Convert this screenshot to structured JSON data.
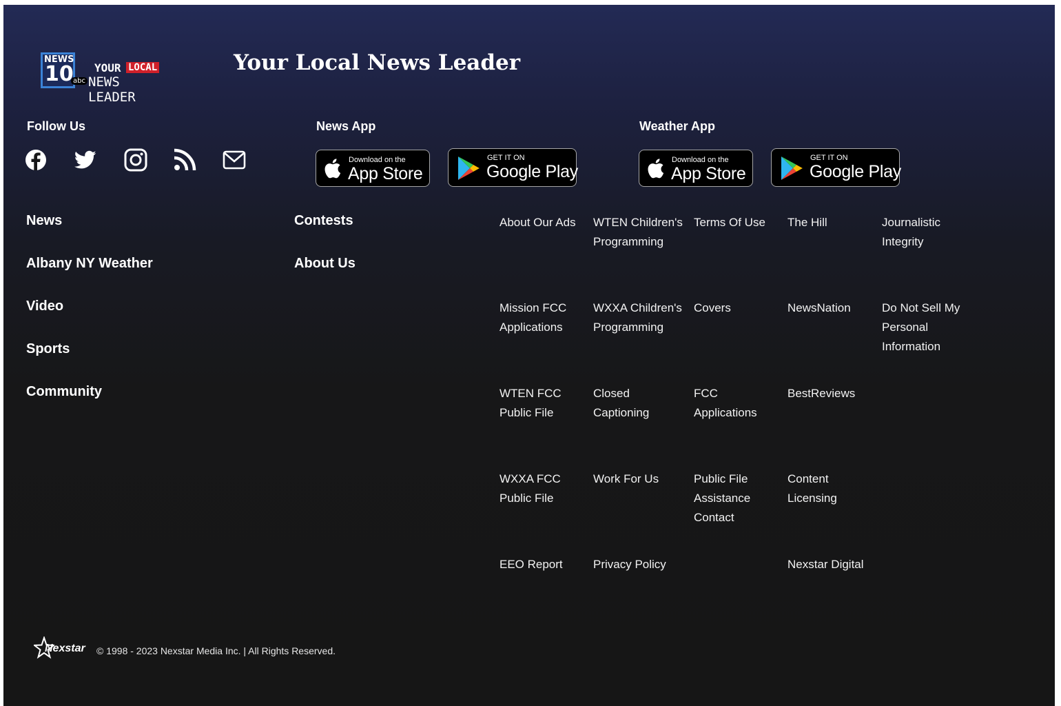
{
  "brand": {
    "logo": {
      "news": "NEWS",
      "number": "10",
      "network": "abc",
      "your": "YOUR",
      "local": "LOCAL",
      "leader": "NEWS LEADER"
    },
    "tagline": "Your Local News Leader"
  },
  "follow": {
    "label": "Follow Us",
    "icons": [
      "facebook-icon",
      "twitter-icon",
      "instagram-icon",
      "rss-icon",
      "email-icon"
    ]
  },
  "news_app": {
    "label": "News App",
    "app_store": {
      "small": "Download on the",
      "big": "App Store"
    },
    "google_play": {
      "small": "GET IT ON",
      "big": "Google Play"
    }
  },
  "weather_app": {
    "label": "Weather App",
    "app_store": {
      "small": "Download on the",
      "big": "App Store"
    },
    "google_play": {
      "small": "GET IT ON",
      "big": "Google Play"
    }
  },
  "nav": {
    "col1": [
      "News",
      "Albany NY Weather",
      "Video",
      "Sports",
      "Community"
    ],
    "col2": [
      "Contests",
      "About Us"
    ]
  },
  "links": {
    "about_our_ads": "About Our Ads",
    "wten_childrens": "WTEN Children's\nProgramming",
    "terms_of_use": "Terms Of Use",
    "the_hill": "The Hill",
    "journalistic_integrity": "Journalistic\nIntegrity",
    "mission_fcc": "Mission FCC\nApplications",
    "wxxa_childrens": "WXXA Children's\nProgramming",
    "covers": "Covers",
    "newsnation": "NewsNation",
    "do_not_sell": "Do Not Sell My\nPersonal\nInformation",
    "wten_fcc": "WTEN FCC\nPublic File",
    "closed_captioning": "Closed\nCaptioning",
    "fcc_applications": "FCC\nApplications",
    "bestreviews": "BestReviews",
    "wxxa_fcc": "WXXA FCC\nPublic File",
    "work_for_us": "Work For Us",
    "public_file_assistance": "Public File\nAssistance\nContact",
    "content_licensing": "Content\nLicensing",
    "eeo_report": "EEO Report",
    "privacy_policy": "Privacy Policy",
    "nexstar_digital": "Nexstar Digital"
  },
  "bottom": {
    "nexstar_logo": "Nexstar",
    "copyright": "© 1998 - 2023 Nexstar Media Inc. | All Rights Reserved."
  }
}
